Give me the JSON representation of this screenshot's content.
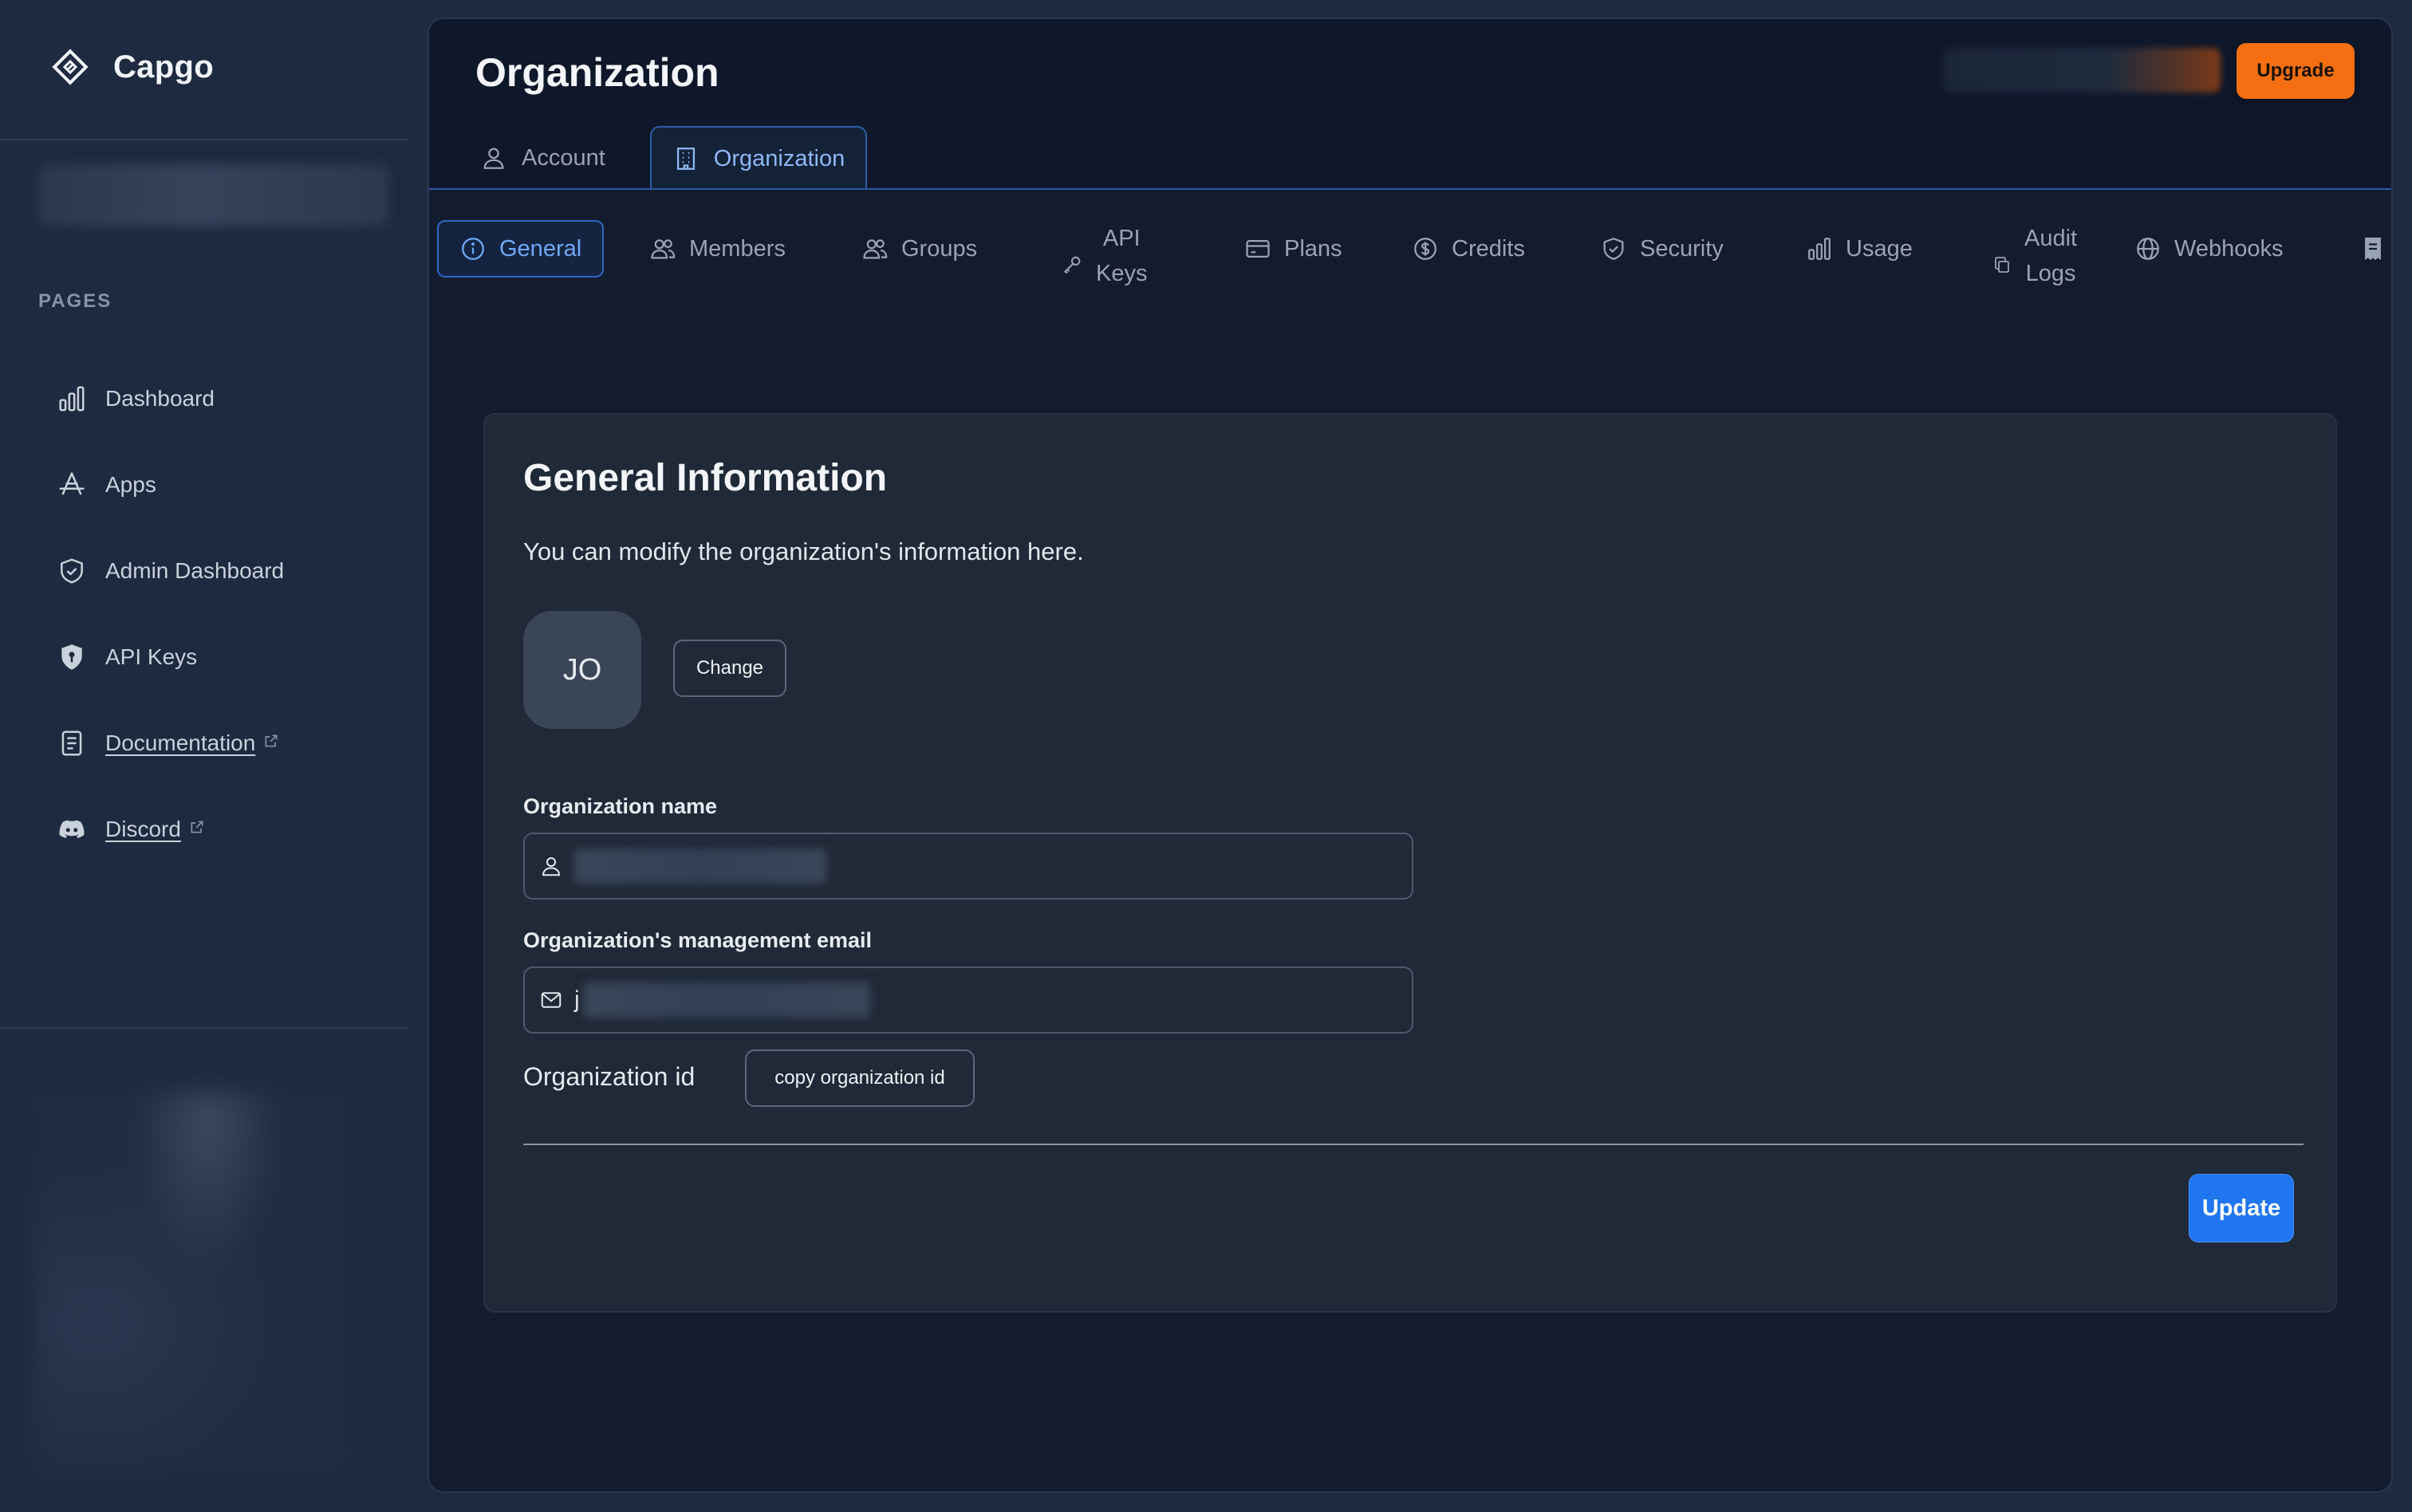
{
  "brand": {
    "name": "Capgo"
  },
  "sidebar": {
    "section_label": "PAGES",
    "items": [
      {
        "label": "Dashboard",
        "icon": "bar-chart-icon",
        "external": false
      },
      {
        "label": "Apps",
        "icon": "app-store-icon",
        "external": false
      },
      {
        "label": "Admin Dashboard",
        "icon": "shield-check-icon",
        "external": false
      },
      {
        "label": "API Keys",
        "icon": "shield-key-icon",
        "external": false
      },
      {
        "label": "Documentation",
        "icon": "document-icon",
        "external": true
      },
      {
        "label": "Discord",
        "icon": "discord-icon",
        "external": true
      }
    ]
  },
  "header": {
    "title": "Organization",
    "upgrade_label": "Upgrade"
  },
  "top_tabs": [
    {
      "label": "Account",
      "icon": "user-icon",
      "active": false
    },
    {
      "label": "Organization",
      "icon": "building-icon",
      "active": true
    }
  ],
  "sub_tabs": [
    {
      "label": "General",
      "icon": "info-icon",
      "active": true
    },
    {
      "label": "Members",
      "icon": "users-icon"
    },
    {
      "label": "Groups",
      "icon": "users-icon"
    },
    {
      "label": "API",
      "label2": "Keys",
      "icon": "key-icon"
    },
    {
      "label": "Plans",
      "icon": "credit-card-icon"
    },
    {
      "label": "Credits",
      "icon": "dollar-icon"
    },
    {
      "label": "Security",
      "icon": "shield-icon"
    },
    {
      "label": "Usage",
      "icon": "bar-chart-icon"
    },
    {
      "label": "Audit",
      "label2": "Logs",
      "icon": "copy-icon"
    },
    {
      "label": "Webhooks",
      "icon": "globe-icon"
    },
    {
      "label": "",
      "icon": "receipt-icon"
    }
  ],
  "card": {
    "title": "General Information",
    "description": "You can modify the organization's information here.",
    "avatar_initials": "JO",
    "change_label": "Change",
    "org_name_label": "Organization name",
    "email_label": "Organization's management email",
    "email_value_visible": "j",
    "org_id_label": "Organization id",
    "copy_id_label": "copy organization id",
    "update_label": "Update"
  },
  "colors": {
    "accent": "#1f76f0",
    "upgrade": "#f46f12",
    "active_tab": "#6fa8f5"
  }
}
